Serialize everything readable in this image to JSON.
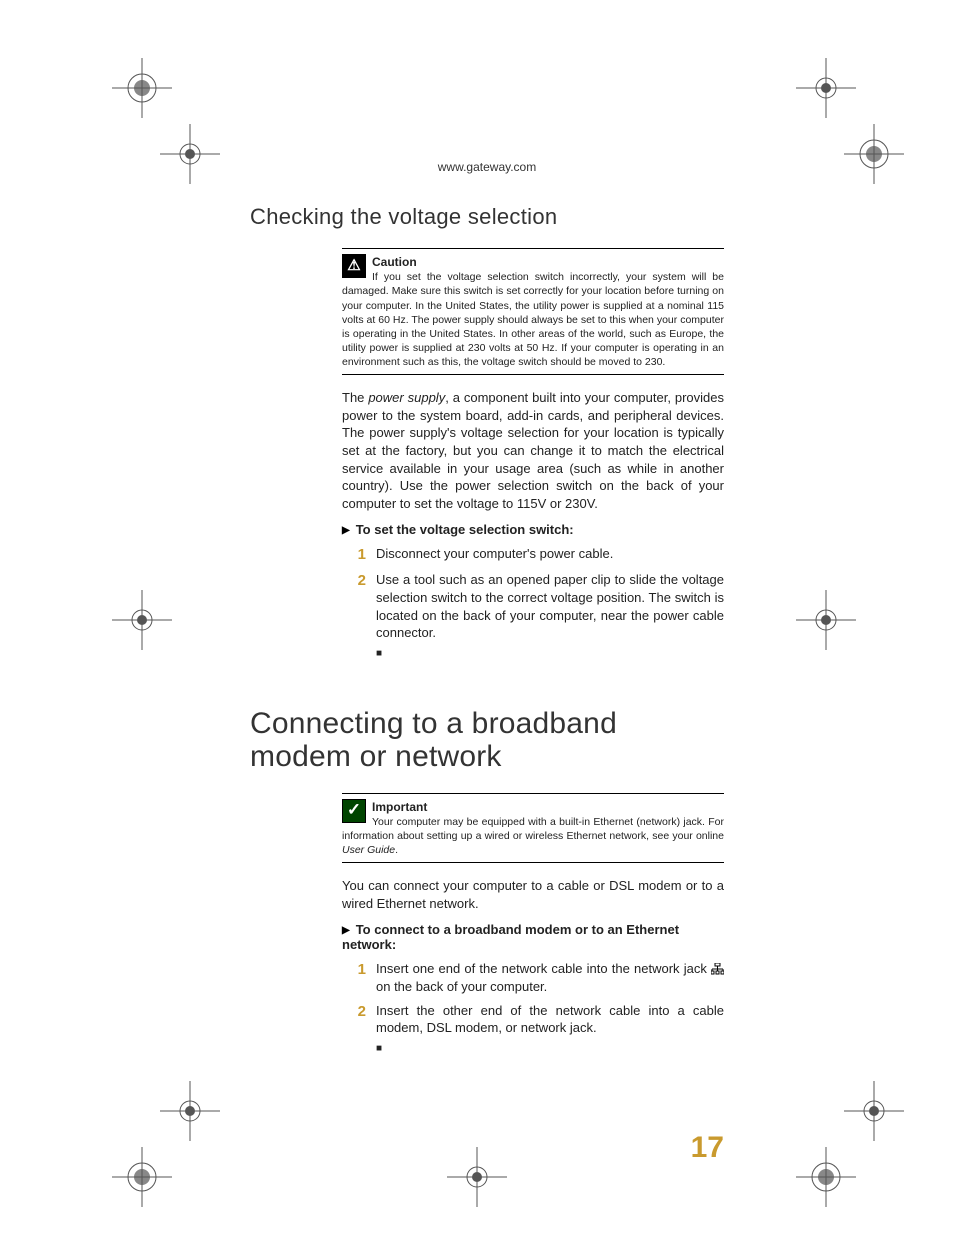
{
  "header_url": "www.gateway.com",
  "section1": {
    "heading": "Checking the voltage selection",
    "caution_title": "Caution",
    "caution_body": "If you set the voltage selection switch incorrectly, your system will be damaged. Make sure this switch is set correctly for your location before turning on your computer. In the United States, the utility power is supplied at a nominal 115 volts at 60 Hz. The power supply should always be set to this when your computer is operating in the United States. In other areas of the world, such as Europe, the utility power is supplied at 230 volts at 50 Hz. If your computer is operating in an environment such as this, the voltage switch should be moved to 230.",
    "body_pre": "The ",
    "body_em": "power supply",
    "body_post": ", a component built into your computer, provides power to the system board, add-in cards, and peripheral devices. The power supply's voltage selection for your location is typically set at the factory, but you can change it to match the electrical service available in your usage area (such as while in another country). Use the power selection switch on the back of your computer to set the voltage to 115V or 230V.",
    "procedure_title": "To set the voltage selection switch:",
    "steps": [
      "Disconnect your computer's power cable.",
      "Use a tool such as an opened paper clip to slide the voltage selection switch to the correct voltage position. The switch is located on the back of your computer, near the power cable connector."
    ]
  },
  "section2": {
    "heading": "Connecting to a broadband modem or network",
    "important_title": "Important",
    "important_body_pre": "Your computer may be equipped with a built-in Ethernet (network) jack. For information about setting up a wired or wireless Ethernet network, see your online ",
    "important_body_em": "User Guide",
    "important_body_post": ".",
    "body": "You can connect your computer to a cable or DSL modem or to a wired Ethernet network.",
    "procedure_title": "To connect to a broadband modem or to an Ethernet network:",
    "step1_pre": "Insert one end of the network cable into the network jack ",
    "step1_post": " on the back of your computer.",
    "step2": "Insert the other end of the network cable into a cable modem, DSL modem, or network jack."
  },
  "page_number": "17"
}
